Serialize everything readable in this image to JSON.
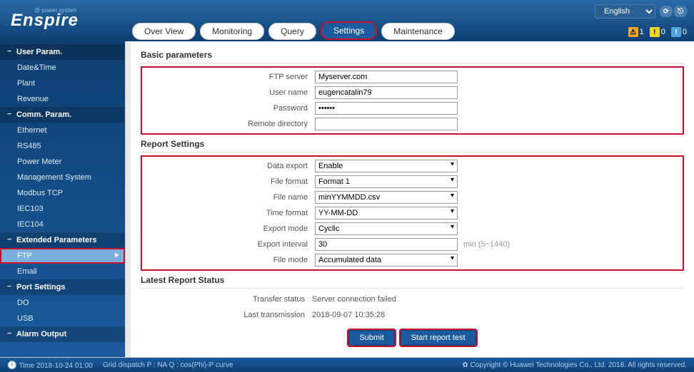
{
  "header": {
    "brand": "Enspire",
    "brand_sub": "@ power system",
    "language": "English",
    "tabs": [
      "Over View",
      "Monitoring",
      "Query",
      "Settings",
      "Maintenance"
    ],
    "active_tab": "Settings",
    "alerts": {
      "critical": "1",
      "major": "0",
      "minor": "0"
    }
  },
  "sidebar": {
    "groups": [
      {
        "title": "User Param.",
        "items": [
          "Date&Time",
          "Plant",
          "Revenue"
        ]
      },
      {
        "title": "Comm. Param.",
        "items": [
          "Ethernet",
          "RS485",
          "Power Meter",
          "Management System",
          "Modbus TCP",
          "IEC103",
          "IEC104"
        ]
      },
      {
        "title": "Extended Parameters",
        "items": [
          "FTP",
          "Email"
        ]
      },
      {
        "title": "Port Settings",
        "items": [
          "DO",
          "USB"
        ]
      },
      {
        "title": "Alarm Output",
        "items": []
      }
    ],
    "active": "FTP"
  },
  "sections": {
    "basic": {
      "title": "Basic parameters",
      "ftp_server_label": "FTP server",
      "ftp_server": "Myserver.com",
      "username_label": "User name",
      "username": "eugencatalin79",
      "password_label": "Password",
      "password": "••••••",
      "remote_dir_label": "Remote directory",
      "remote_dir": ""
    },
    "report": {
      "title": "Report Settings",
      "data_export_label": "Data export",
      "data_export": "Enable",
      "file_format_label": "File format",
      "file_format": "Format 1",
      "file_name_label": "File name",
      "file_name": "minYYMMDD.csv",
      "time_format_label": "Time format",
      "time_format": "YY-MM-DD",
      "export_mode_label": "Export mode",
      "export_mode": "Cyclic",
      "export_interval_label": "Export interval",
      "export_interval": "30",
      "export_interval_hint": "min (5~1440)",
      "file_mode_label": "File mode",
      "file_mode": "Accumulated data"
    },
    "status": {
      "title": "Latest Report Status",
      "transfer_label": "Transfer status",
      "transfer": "Server connection failed",
      "last_label": "Last transmission",
      "last": "2018-09-07 10:35:28"
    }
  },
  "buttons": {
    "submit": "Submit",
    "start_test": "Start report test"
  },
  "footer": {
    "time_label": "Time",
    "time": "2018-10-24 01:00",
    "grid": "Grid dispatch  P : NA   Q : cos(Phi)-P curve",
    "copyright": "Copyright © Huawei Technologies Co., Ltd. 2018. All rights reserved."
  }
}
